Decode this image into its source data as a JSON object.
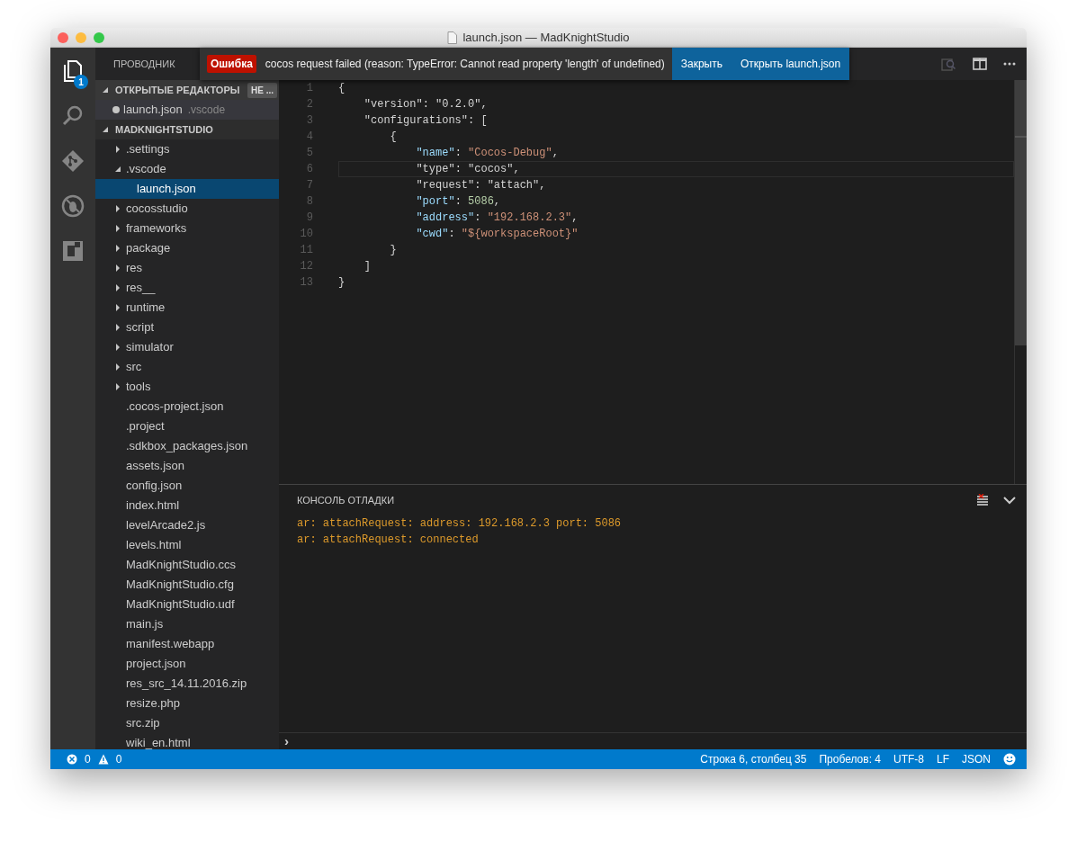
{
  "window": {
    "title": "launch.json — MadKnightStudio"
  },
  "activity_bar": [
    {
      "kind": "files",
      "selected": true,
      "badge": "1"
    },
    {
      "kind": "search",
      "selected": false
    },
    {
      "kind": "git",
      "selected": false
    },
    {
      "kind": "debug",
      "selected": false
    },
    {
      "kind": "extensions",
      "selected": false
    }
  ],
  "sidebar": {
    "title": "ПРОВОДНИК",
    "open_editors": {
      "title": "ОТКРЫТЫЕ РЕДАКТОРЫ",
      "expanded": true,
      "badge": "НЕ ...",
      "items": [
        {
          "label": "launch.json",
          "path": ".vscode",
          "dirty": true
        }
      ]
    },
    "folder": {
      "title": "MADKNIGHTSTUDIO",
      "expanded": true,
      "items": [
        {
          "label": ".settings",
          "kind": "folder",
          "expanded": false,
          "selected": false
        },
        {
          "label": ".vscode",
          "kind": "folder",
          "expanded": true,
          "selected": false,
          "children": [
            {
              "label": "launch.json",
              "kind": "file",
              "selected": true
            }
          ]
        },
        {
          "label": "cocosstudio",
          "kind": "folder",
          "expanded": false,
          "selected": false
        },
        {
          "label": "frameworks",
          "kind": "folder",
          "expanded": false,
          "selected": false
        },
        {
          "label": "package",
          "kind": "folder",
          "expanded": false,
          "selected": false
        },
        {
          "label": "res",
          "kind": "folder",
          "expanded": false,
          "selected": false
        },
        {
          "label": "res__",
          "kind": "folder",
          "expanded": false,
          "selected": false
        },
        {
          "label": "runtime",
          "kind": "folder",
          "expanded": false,
          "selected": false
        },
        {
          "label": "script",
          "kind": "folder",
          "expanded": false,
          "selected": false
        },
        {
          "label": "simulator",
          "kind": "folder",
          "expanded": false,
          "selected": false
        },
        {
          "label": "src",
          "kind": "folder",
          "expanded": false,
          "selected": false
        },
        {
          "label": "tools",
          "kind": "folder",
          "expanded": false,
          "selected": false
        },
        {
          "label": ".cocos-project.json",
          "kind": "file",
          "selected": false
        },
        {
          "label": ".project",
          "kind": "file",
          "selected": false
        },
        {
          "label": ".sdkbox_packages.json",
          "kind": "file",
          "selected": false
        },
        {
          "label": "assets.json",
          "kind": "file",
          "selected": false
        },
        {
          "label": "config.json",
          "kind": "file",
          "selected": false
        },
        {
          "label": "index.html",
          "kind": "file",
          "selected": false
        },
        {
          "label": "levelArcade2.js",
          "kind": "file",
          "selected": false
        },
        {
          "label": "levels.html",
          "kind": "file",
          "selected": false
        },
        {
          "label": "MadKnightStudio.ccs",
          "kind": "file",
          "selected": false
        },
        {
          "label": "MadKnightStudio.cfg",
          "kind": "file",
          "selected": false
        },
        {
          "label": "MadKnightStudio.udf",
          "kind": "file",
          "selected": false
        },
        {
          "label": "main.js",
          "kind": "file",
          "selected": false
        },
        {
          "label": "manifest.webapp",
          "kind": "file",
          "selected": false
        },
        {
          "label": "project.json",
          "kind": "file",
          "selected": false
        },
        {
          "label": "res_src_14.11.2016.zip",
          "kind": "file",
          "selected": false
        },
        {
          "label": "resize.php",
          "kind": "file",
          "selected": false
        },
        {
          "label": "src.zip",
          "kind": "file",
          "selected": false
        },
        {
          "label": "wiki_en.html",
          "kind": "file",
          "selected": false
        }
      ]
    }
  },
  "notification": {
    "severity": "Ошибка",
    "message": "cocos request failed (reason: TypeError: Cannot read property 'length' of undefined)",
    "actions": [
      "Закрыть",
      "Открыть launch.json"
    ]
  },
  "editor": {
    "lines": [
      {
        "number": "1",
        "current": false,
        "tokens": [
          {
            "text": "{",
            "kind": "punct"
          }
        ]
      },
      {
        "number": "2",
        "current": false,
        "tokens": [
          {
            "text": "    \"version\"",
            "kind": "plain"
          },
          {
            "text": ": ",
            "kind": "punct"
          },
          {
            "text": "\"0.2.0\"",
            "kind": "plain"
          },
          {
            "text": ",",
            "kind": "punct"
          }
        ]
      },
      {
        "number": "3",
        "current": false,
        "tokens": [
          {
            "text": "    \"configurations\"",
            "kind": "plain"
          },
          {
            "text": ": [",
            "kind": "punct"
          }
        ]
      },
      {
        "number": "4",
        "current": false,
        "tokens": [
          {
            "text": "        {",
            "kind": "punct"
          }
        ]
      },
      {
        "number": "5",
        "current": false,
        "tokens": [
          {
            "text": "            \"name\"",
            "kind": "key"
          },
          {
            "text": ": ",
            "kind": "punct"
          },
          {
            "text": "\"Cocos-Debug\"",
            "kind": "string"
          },
          {
            "text": ",",
            "kind": "punct"
          }
        ]
      },
      {
        "number": "6",
        "current": true,
        "tokens": [
          {
            "text": "            \"type\"",
            "kind": "plain"
          },
          {
            "text": ": ",
            "kind": "punct"
          },
          {
            "text": "\"cocos\"",
            "kind": "plain"
          },
          {
            "text": ",",
            "kind": "punct"
          }
        ]
      },
      {
        "number": "7",
        "current": false,
        "tokens": [
          {
            "text": "            \"request\"",
            "kind": "plain"
          },
          {
            "text": ": ",
            "kind": "punct"
          },
          {
            "text": "\"attach\"",
            "kind": "plain"
          },
          {
            "text": ",",
            "kind": "punct"
          }
        ]
      },
      {
        "number": "8",
        "current": false,
        "tokens": [
          {
            "text": "            \"port\"",
            "kind": "key"
          },
          {
            "text": ": ",
            "kind": "punct"
          },
          {
            "text": "5086",
            "kind": "number"
          },
          {
            "text": ",",
            "kind": "punct"
          }
        ]
      },
      {
        "number": "9",
        "current": false,
        "tokens": [
          {
            "text": "            \"address\"",
            "kind": "key"
          },
          {
            "text": ": ",
            "kind": "punct"
          },
          {
            "text": "\"192.168.2.3\"",
            "kind": "string"
          },
          {
            "text": ",",
            "kind": "punct"
          }
        ]
      },
      {
        "number": "10",
        "current": false,
        "tokens": [
          {
            "text": "            \"cwd\"",
            "kind": "key"
          },
          {
            "text": ": ",
            "kind": "punct"
          },
          {
            "text": "\"${workspaceRoot}\"",
            "kind": "string"
          }
        ]
      },
      {
        "number": "11",
        "current": false,
        "tokens": [
          {
            "text": "        }",
            "kind": "punct"
          }
        ]
      },
      {
        "number": "12",
        "current": false,
        "tokens": [
          {
            "text": "    ]",
            "kind": "punct"
          }
        ]
      },
      {
        "number": "13",
        "current": false,
        "tokens": [
          {
            "text": "}",
            "kind": "punct"
          }
        ]
      }
    ]
  },
  "panel": {
    "title": "КОНСОЛЬ ОТЛАДКИ",
    "output": [
      "ar: attachRequest: address: 192.168.2.3 port: 5086",
      "ar: attachRequest: connected"
    ],
    "prompt": "›"
  },
  "status_bar": {
    "errors": "0",
    "warnings": "0",
    "items": [
      "Строка 6, столбец 35",
      "Пробелов: 4",
      "UTF-8",
      "LF",
      "JSON"
    ]
  }
}
